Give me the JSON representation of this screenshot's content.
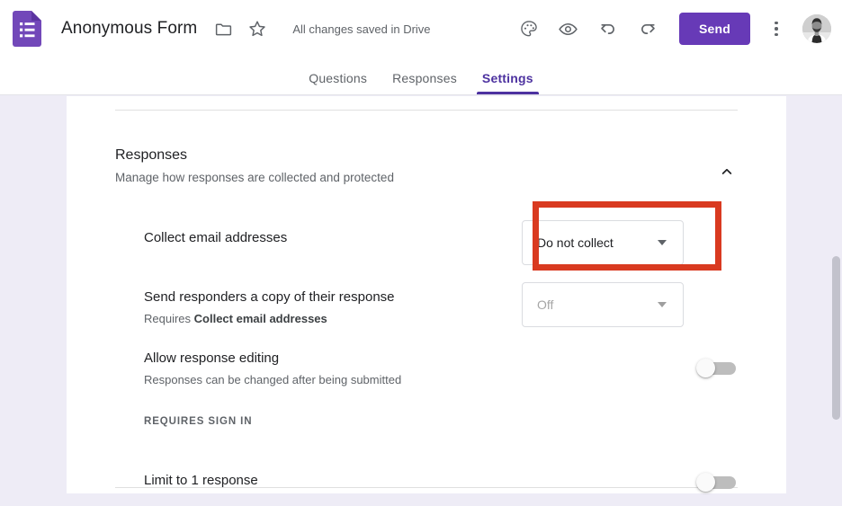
{
  "colors": {
    "brand_purple": "#673ab7",
    "tab_active": "#4d32a0",
    "annotation_red": "#d93a20",
    "page_bg": "#eeecf6",
    "toggle_off_track": "#bdbdbd"
  },
  "topbar": {
    "logo_icon": "google-forms-icon",
    "title": "Anonymous Form",
    "move_folder_icon": "folder-icon",
    "star_icon": "star-outline-icon",
    "save_status": "All changes saved in Drive",
    "theme_icon": "palette-icon",
    "preview_icon": "eye-preview-icon",
    "undo_icon": "undo-icon",
    "redo_icon": "redo-icon",
    "send_label": "Send",
    "more_icon": "kebab-menu-icon",
    "avatar_icon": "user-avatar"
  },
  "tabs": [
    {
      "label": "Questions",
      "active": false
    },
    {
      "label": "Responses",
      "active": false
    },
    {
      "label": "Settings",
      "active": true
    }
  ],
  "settings": {
    "section": {
      "title": "Responses",
      "subtitle": "Manage how responses are collected and protected",
      "collapse_icon": "chevron-up-icon",
      "expanded": true
    },
    "rows": [
      {
        "type": "dropdown",
        "label": "Collect email addresses",
        "sub": "",
        "sub_bold": "",
        "value": "Do not collect",
        "disabled": false,
        "highlighted": true
      },
      {
        "type": "dropdown",
        "label": "Send responders a copy of their response",
        "sub": "Requires ",
        "sub_bold": "Collect email addresses",
        "value": "Off",
        "disabled": true,
        "highlighted": false
      },
      {
        "type": "toggle",
        "label": "Allow response editing",
        "sub": "Responses can be changed after being submitted",
        "sub_bold": "",
        "state": "off",
        "highlighted": false
      },
      {
        "type": "section-label",
        "label": "REQUIRES SIGN IN"
      },
      {
        "type": "toggle",
        "label": "Limit to 1 response",
        "sub": "",
        "sub_bold": "",
        "state": "off",
        "highlighted": false
      }
    ]
  },
  "scrollbar": {
    "name": "vertical-scrollbar"
  }
}
